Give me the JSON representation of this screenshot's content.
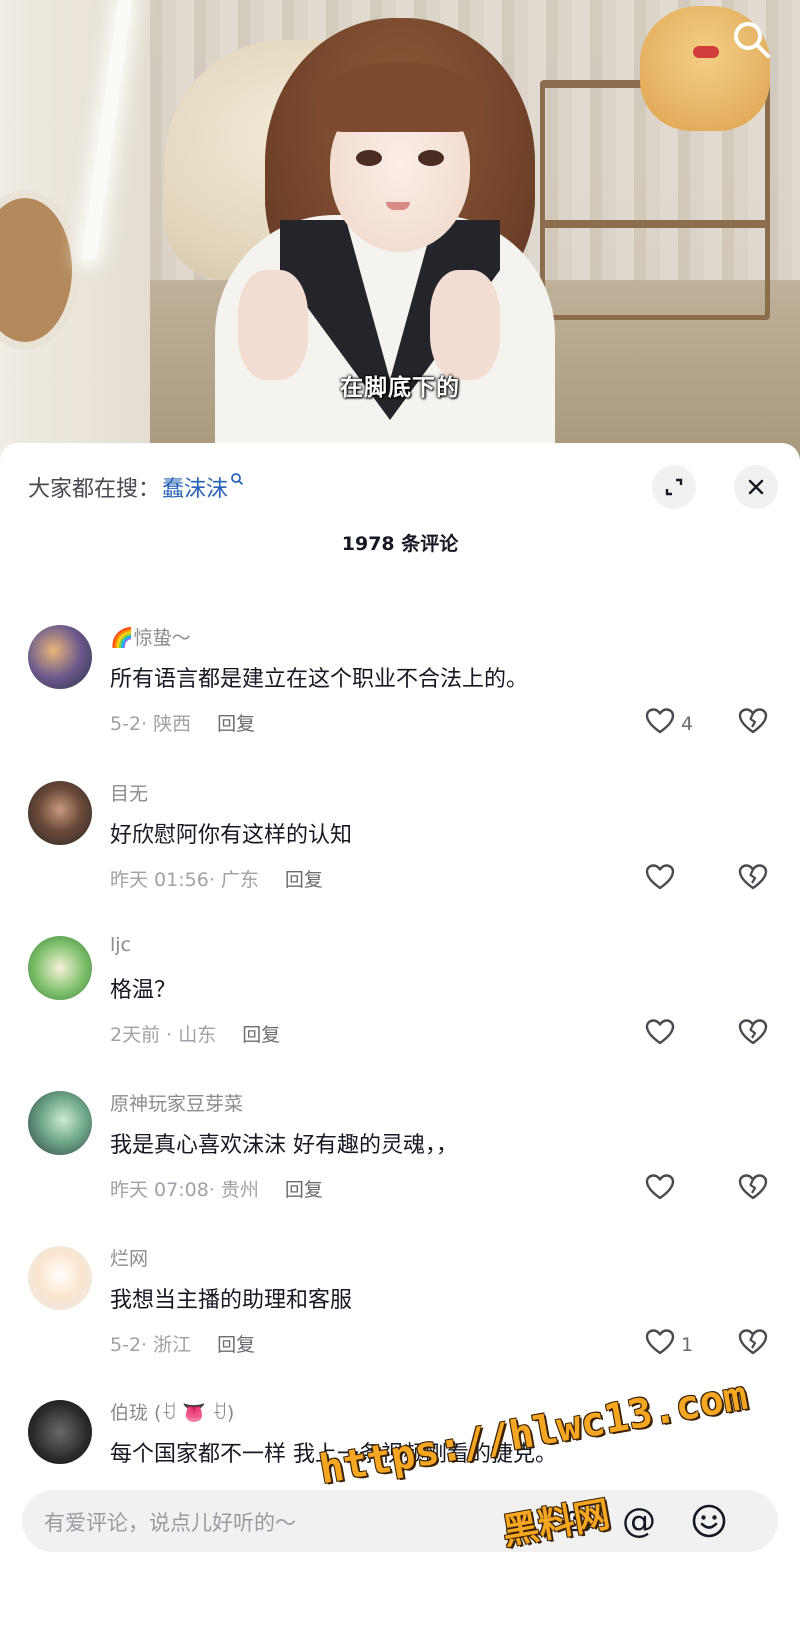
{
  "video": {
    "subtitle": "在脚底下的",
    "search_icon": "search-icon"
  },
  "sheet": {
    "search_prefix": "大家都在搜：",
    "search_keyword": "蠢沫沫",
    "comment_count": "1978 条评论",
    "expand_icon": "expand-icon",
    "close_icon": "close-icon"
  },
  "comments": [
    {
      "user": "🌈惊蛰～",
      "text": "所有语言都是建立在这个职业不合法上的。",
      "meta": "5-2· 陕西",
      "reply": "回复",
      "likes": "4"
    },
    {
      "user": "目无",
      "text": "好欣慰阿你有这样的认知",
      "meta": "昨天 01:56· 广东",
      "reply": "回复",
      "likes": ""
    },
    {
      "user": "ljc",
      "text": "格温？",
      "meta": "2天前 · 山东",
      "reply": "回复",
      "likes": ""
    },
    {
      "user": "原神玩家豆芽菜",
      "text": "我是真心喜欢沫沫 好有趣的灵魂，，",
      "meta": "昨天 07:08· 贵州",
      "reply": "回复",
      "likes": ""
    },
    {
      "user": "烂网",
      "text": "我想当主播的助理和客服",
      "meta": "5-2· 浙江",
      "reply": "回复",
      "likes": "1"
    },
    {
      "user": "伯珑 (ꀀ 👅 ꀀ)",
      "text": "每个国家都不一样 我上一条视频刚看的捷克。",
      "meta": "",
      "reply": "",
      "likes": ""
    }
  ],
  "input": {
    "placeholder": "有爱评论，说点儿好听的～",
    "mention_label": "@",
    "emoji_icon": "emoji-icon",
    "image_icon": "image-icon"
  },
  "watermark": {
    "url": "https://hlwc13.com",
    "name": "黑料网"
  },
  "colors": {
    "keyword_blue": "#2a63b8",
    "watermark_orange": "#f5a623"
  }
}
